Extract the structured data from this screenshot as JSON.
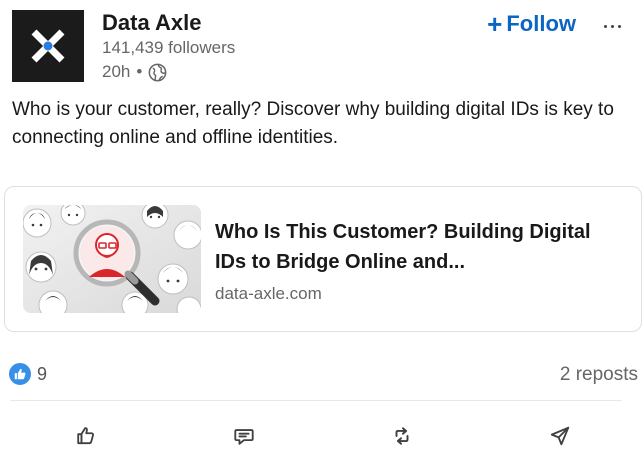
{
  "actor": {
    "name": "Data Axle",
    "followers": "141,439 followers",
    "time": "20h",
    "separator": "•",
    "logo_icon": "data-axle-x-logo",
    "visibility_icon": "globe-icon"
  },
  "header": {
    "follow_plus": "+",
    "follow_label": "Follow",
    "more_icon": "ellipsis-icon"
  },
  "post": {
    "commentary": "Who is your customer, really? Discover why building digital IDs is key to connecting online and offline identities."
  },
  "article": {
    "title": "Who Is This Customer? Building Digital IDs to Bridge Online and...",
    "domain": "data-axle.com",
    "thumbnail_icon": "magnifier-over-faces-image"
  },
  "social": {
    "reaction_icon": "like-reaction-icon",
    "reaction_count": "9",
    "reposts": "2 reposts"
  },
  "actions": [
    {
      "icon": "like-thumb-icon"
    },
    {
      "icon": "comment-icon"
    },
    {
      "icon": "repost-icon"
    },
    {
      "icon": "send-icon"
    }
  ],
  "colors": {
    "accent": "#0a66c2",
    "reaction": "#378fe9",
    "logo_bg": "#1b1b1b",
    "logo_dot": "#2a7de1",
    "secondary_text": "#666666"
  }
}
